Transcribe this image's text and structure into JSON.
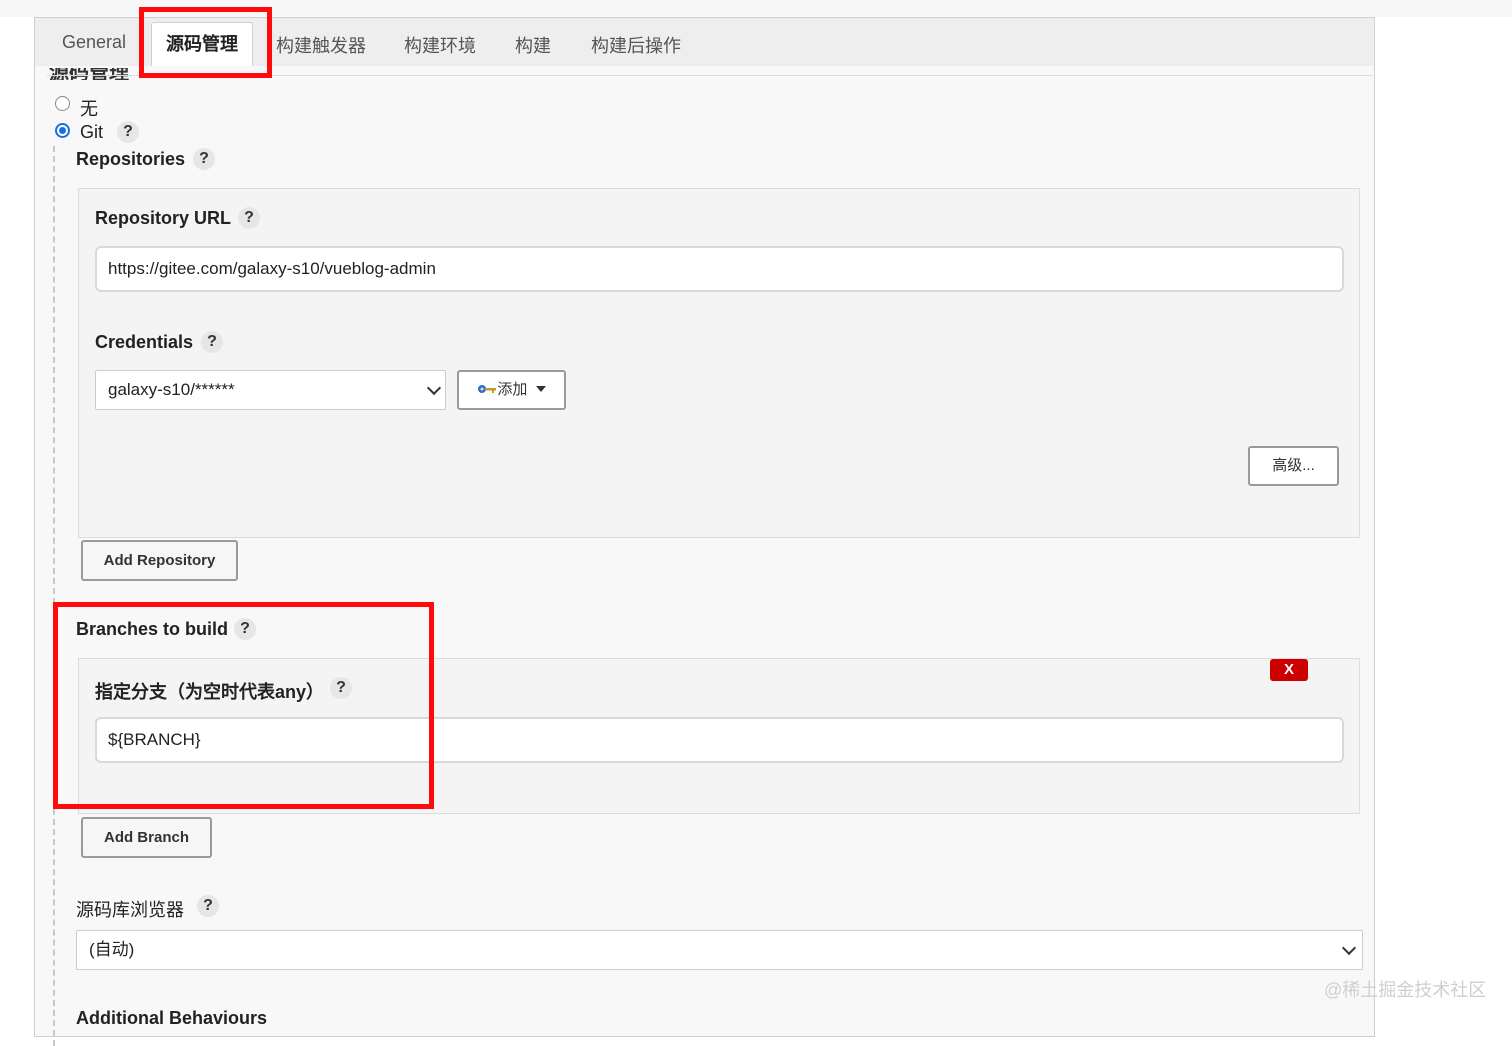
{
  "tabs": [
    "General",
    "源码管理",
    "构建触发器",
    "构建环境",
    "构建",
    "构建后操作"
  ],
  "section_title": "源码管理",
  "scm": {
    "option_none": "无",
    "option_git": "Git",
    "selected": "Git"
  },
  "help_glyph": "?",
  "repositories": {
    "label": "Repositories",
    "url_label": "Repository URL",
    "url_value": "https://gitee.com/galaxy-s10/vueblog-admin",
    "credentials_label": "Credentials",
    "credentials_value": "galaxy-s10/******",
    "add_credentials_label": "添加",
    "advanced_button": "高级...",
    "add_repository_button": "Add Repository"
  },
  "branches": {
    "label": "Branches to build",
    "specifier_label": "指定分支（为空时代表any）",
    "specifier_value": "${BRANCH}",
    "delete_button": "X",
    "add_branch_button": "Add Branch"
  },
  "browser": {
    "label": "源码库浏览器",
    "value": "(自动)"
  },
  "additional_behaviours": {
    "label": "Additional Behaviours"
  },
  "watermark": "@稀土掘金技术社区",
  "colors": {
    "highlight": "#ff0b0b",
    "radio_selected": "#1a6fe0",
    "delete_button": "#cc0000"
  }
}
